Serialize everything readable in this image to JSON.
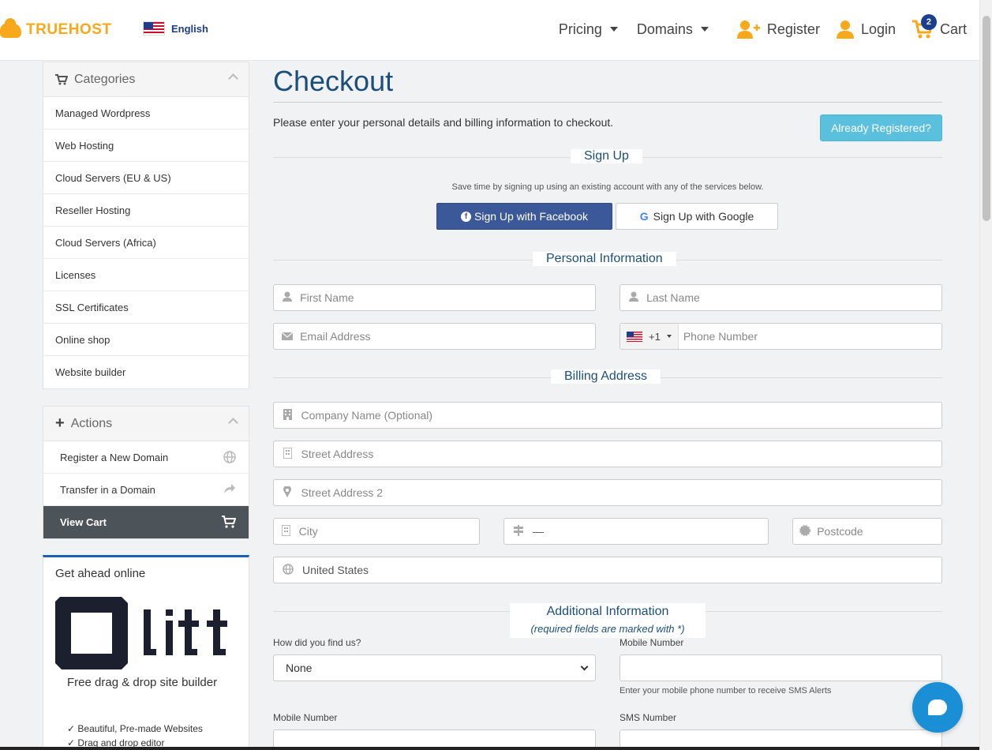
{
  "header": {
    "brand": "TRUEHOST",
    "language": "English",
    "nav": {
      "pricing": "Pricing",
      "domains": "Domains",
      "register": "Register",
      "login": "Login",
      "cart": "Cart",
      "cart_count": "2"
    }
  },
  "sidebar": {
    "categories_title": "Categories",
    "categories": [
      "Managed Wordpress",
      "Web Hosting",
      "Cloud Servers (EU & US)",
      "Reseller Hosting",
      "Cloud Servers (Africa)",
      "Licenses",
      "SSL Certificates",
      "Online shop",
      "Website builder"
    ],
    "actions_title": "Actions",
    "actions": [
      {
        "label": "Register a New Domain",
        "icon": "globe-icon"
      },
      {
        "label": "Transfer in a Domain",
        "icon": "share-arrow-icon"
      },
      {
        "label": "View Cart",
        "icon": "cart-icon"
      }
    ],
    "promo": {
      "title": "Get ahead online",
      "logo_text": "litt",
      "subtitle": "Free drag & drop site builder",
      "features": [
        "Beautiful, Pre-made Websites",
        "Drag and drop editor"
      ]
    }
  },
  "checkout": {
    "title": "Checkout",
    "intro": "Please enter your personal details and billing information to checkout.",
    "already_registered": "Already Registered?",
    "signup": {
      "heading": "Sign Up",
      "note": "Save time by signing up using an existing account with any of the services below.",
      "facebook": "Sign Up with Facebook",
      "google": "Sign Up with Google"
    },
    "personal": {
      "heading": "Personal Information",
      "first_name_ph": "First Name",
      "last_name_ph": "Last Name",
      "email_ph": "Email Address",
      "phone_code": "+1",
      "phone_ph": "Phone Number"
    },
    "billing": {
      "heading": "Billing Address",
      "company_ph": "Company Name (Optional)",
      "street_ph": "Street Address",
      "street2_ph": "Street Address 2",
      "city_ph": "City",
      "state_value": "—",
      "postcode_ph": "Postcode",
      "country_value": "United States"
    },
    "additional": {
      "heading": "Additional Information",
      "note": "(required fields are marked with *)",
      "how_found_label": "How did you find us?",
      "how_found_value": "None",
      "mobile_label": "Mobile Number",
      "mobile_help": "Enter your mobile phone number to receive SMS Alerts",
      "mobile_label_2": "Mobile Number",
      "sms_label": "SMS Number"
    }
  },
  "colors": {
    "brand_orange": "#f7a81b",
    "title_blue": "#1b4f7a",
    "info_button": "#5bc0de",
    "facebook": "#3b5998",
    "chat": "#1a8fd6"
  }
}
